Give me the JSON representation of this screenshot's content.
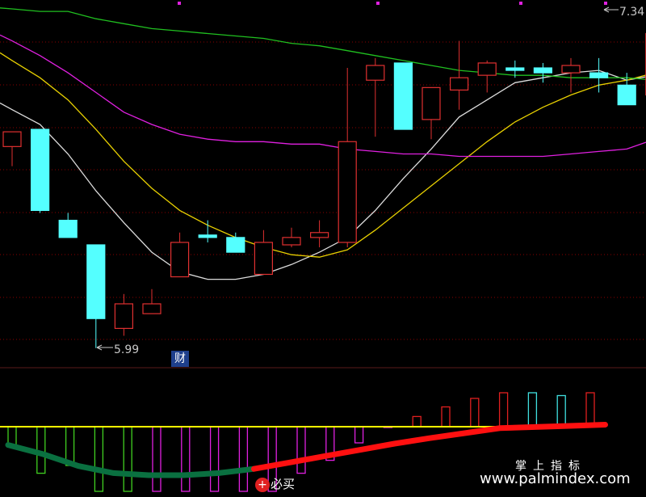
{
  "colors": {
    "up": "#e03030",
    "down": "#54ffff",
    "grid": "#8b0000",
    "ma_white": "#dcdcdc",
    "ma_yellow": "#e8d000",
    "ma_magenta": "#e020e0",
    "ma_green": "#20c020",
    "macd_green": "#40d020",
    "macd_magenta": "#e020e0",
    "macd_red": "#e02020",
    "macd_cyan": "#40e0e0",
    "signal_dark_green": "#0a7040",
    "signal_red": "#ff1010",
    "zero_line": "#ffff00"
  },
  "labels": {
    "low_price": "5.99",
    "high_price": "7.34",
    "finance_tag": "财",
    "buy_signal_icon": "+",
    "buy_signal_text": "必买",
    "watermark_cn": "掌上指标",
    "watermark_url": "www.palmindex.com"
  },
  "chart_data": [
    {
      "type": "candlestick",
      "price_range": [
        5.92,
        7.38
      ],
      "candles": [
        {
          "o": 6.81,
          "h": 6.86,
          "l": 6.73,
          "c": 6.87
        },
        {
          "o": 6.88,
          "h": 6.88,
          "l": 6.54,
          "c": 6.55
        },
        {
          "o": 6.51,
          "h": 6.54,
          "l": 6.44,
          "c": 6.44
        },
        {
          "o": 6.41,
          "h": 6.41,
          "l": 5.99,
          "c": 6.11
        },
        {
          "o": 6.07,
          "h": 6.21,
          "l": 6.04,
          "c": 6.17
        },
        {
          "o": 6.13,
          "h": 6.23,
          "l": 6.13,
          "c": 6.17
        },
        {
          "o": 6.28,
          "h": 6.46,
          "l": 6.28,
          "c": 6.42
        },
        {
          "o": 6.45,
          "h": 6.51,
          "l": 6.42,
          "c": 6.44
        },
        {
          "o": 6.44,
          "h": 6.46,
          "l": 6.38,
          "c": 6.38
        },
        {
          "o": 6.29,
          "h": 6.47,
          "l": 6.29,
          "c": 6.42
        },
        {
          "o": 6.41,
          "h": 6.48,
          "l": 6.4,
          "c": 6.44
        },
        {
          "o": 6.44,
          "h": 6.51,
          "l": 6.4,
          "c": 6.46
        },
        {
          "o": 6.42,
          "h": 7.13,
          "l": 6.4,
          "c": 6.83
        },
        {
          "o": 7.08,
          "h": 7.17,
          "l": 6.85,
          "c": 7.14
        },
        {
          "o": 7.15,
          "h": 7.15,
          "l": 6.88,
          "c": 6.88
        },
        {
          "o": 6.92,
          "h": 7.05,
          "l": 6.84,
          "c": 7.05
        },
        {
          "o": 7.04,
          "h": 7.24,
          "l": 6.96,
          "c": 7.09
        },
        {
          "o": 7.1,
          "h": 7.16,
          "l": 7.03,
          "c": 7.15
        },
        {
          "o": 7.13,
          "h": 7.16,
          "l": 7.09,
          "c": 7.12
        },
        {
          "o": 7.13,
          "h": 7.15,
          "l": 7.07,
          "c": 7.11
        },
        {
          "o": 7.11,
          "h": 7.17,
          "l": 7.03,
          "c": 7.14
        },
        {
          "o": 7.11,
          "h": 7.17,
          "l": 7.03,
          "c": 7.09
        },
        {
          "o": 7.06,
          "h": 7.11,
          "l": 6.98,
          "c": 6.98
        },
        {
          "o": 7.02,
          "h": 7.34,
          "l": 6.83,
          "c": 7.27
        }
      ],
      "ma": [
        {
          "color_key": "ma_white",
          "values": [
            6.96,
            6.9,
            6.78,
            6.63,
            6.5,
            6.38,
            6.3,
            6.27,
            6.27,
            6.29,
            6.33,
            6.38,
            6.44,
            6.55,
            6.68,
            6.8,
            6.93,
            7.0,
            7.07,
            7.09,
            7.11,
            7.12,
            7.08,
            7.1
          ]
        },
        {
          "color_key": "ma_yellow",
          "values": [
            7.16,
            7.09,
            7.0,
            6.88,
            6.75,
            6.64,
            6.55,
            6.49,
            6.44,
            6.4,
            6.37,
            6.36,
            6.39,
            6.47,
            6.56,
            6.65,
            6.74,
            6.83,
            6.91,
            6.97,
            7.02,
            7.06,
            7.08,
            7.11
          ]
        },
        {
          "color_key": "ma_magenta",
          "values": [
            7.24,
            7.18,
            7.11,
            7.03,
            6.95,
            6.9,
            6.86,
            6.84,
            6.83,
            6.83,
            6.82,
            6.82,
            6.8,
            6.79,
            6.78,
            6.78,
            6.77,
            6.77,
            6.77,
            6.77,
            6.78,
            6.79,
            6.8,
            6.84
          ]
        },
        {
          "color_key": "ma_green",
          "values": [
            7.37,
            7.36,
            7.36,
            7.33,
            7.31,
            7.29,
            7.28,
            7.27,
            7.26,
            7.25,
            7.23,
            7.22,
            7.2,
            7.18,
            7.16,
            7.14,
            7.12,
            7.11,
            7.1,
            7.1,
            7.09,
            7.09,
            7.09,
            7.08
          ]
        }
      ]
    },
    {
      "type": "bar",
      "macd_range": [
        -1.0,
        0.6
      ],
      "bars": [
        {
          "v": -0.3,
          "color_key": "macd_green"
        },
        {
          "v": -0.72,
          "color_key": "macd_green"
        },
        {
          "v": -0.6,
          "color_key": "macd_green"
        },
        {
          "v": -1.0,
          "color_key": "macd_green"
        },
        {
          "v": -1.0,
          "color_key": "macd_green"
        },
        {
          "v": -1.0,
          "color_key": "macd_magenta"
        },
        {
          "v": -1.0,
          "color_key": "macd_magenta"
        },
        {
          "v": -1.0,
          "color_key": "macd_magenta"
        },
        {
          "v": -1.0,
          "color_key": "macd_magenta"
        },
        {
          "v": -1.0,
          "color_key": "macd_magenta"
        },
        {
          "v": -0.72,
          "color_key": "macd_magenta"
        },
        {
          "v": -0.52,
          "color_key": "macd_magenta"
        },
        {
          "v": -0.25,
          "color_key": "macd_magenta"
        },
        {
          "v": 0.0,
          "color_key": "macd_magenta"
        },
        {
          "v": 0.18,
          "color_key": "macd_red"
        },
        {
          "v": 0.35,
          "color_key": "macd_red"
        },
        {
          "v": 0.5,
          "color_key": "macd_red"
        },
        {
          "v": 0.6,
          "color_key": "macd_red"
        },
        {
          "v": 0.6,
          "color_key": "macd_cyan"
        },
        {
          "v": 0.55,
          "color_key": "macd_cyan"
        },
        {
          "v": 0.6,
          "color_key": "macd_red"
        }
      ],
      "signal": [
        -0.28,
        -0.5,
        -0.78,
        -0.95,
        -1.0,
        -1.0,
        -0.95,
        -0.85,
        -0.7,
        -0.55,
        -0.4,
        -0.25,
        -0.12,
        0.0,
        0.06,
        0.1,
        0.14,
        0.18
      ]
    }
  ]
}
